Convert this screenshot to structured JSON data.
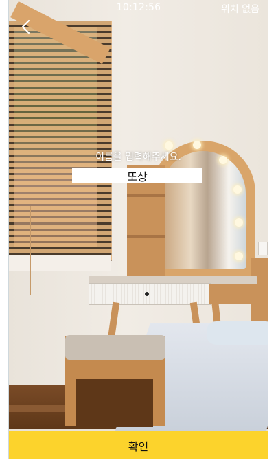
{
  "status_bar": {
    "time": "10:12:56",
    "location_status": "위치 없음"
  },
  "navigation": {
    "back_icon": "chevron-left-icon"
  },
  "name_prompt": {
    "label": "이름을 입력해주세요.",
    "input_value": "또상"
  },
  "footer": {
    "confirm_label": "확인"
  },
  "colors": {
    "confirm_button": "#fcd32c",
    "overlay_text": "#ffffff",
    "input_background": "#ffffff"
  },
  "background_image": "room-interior-photo"
}
